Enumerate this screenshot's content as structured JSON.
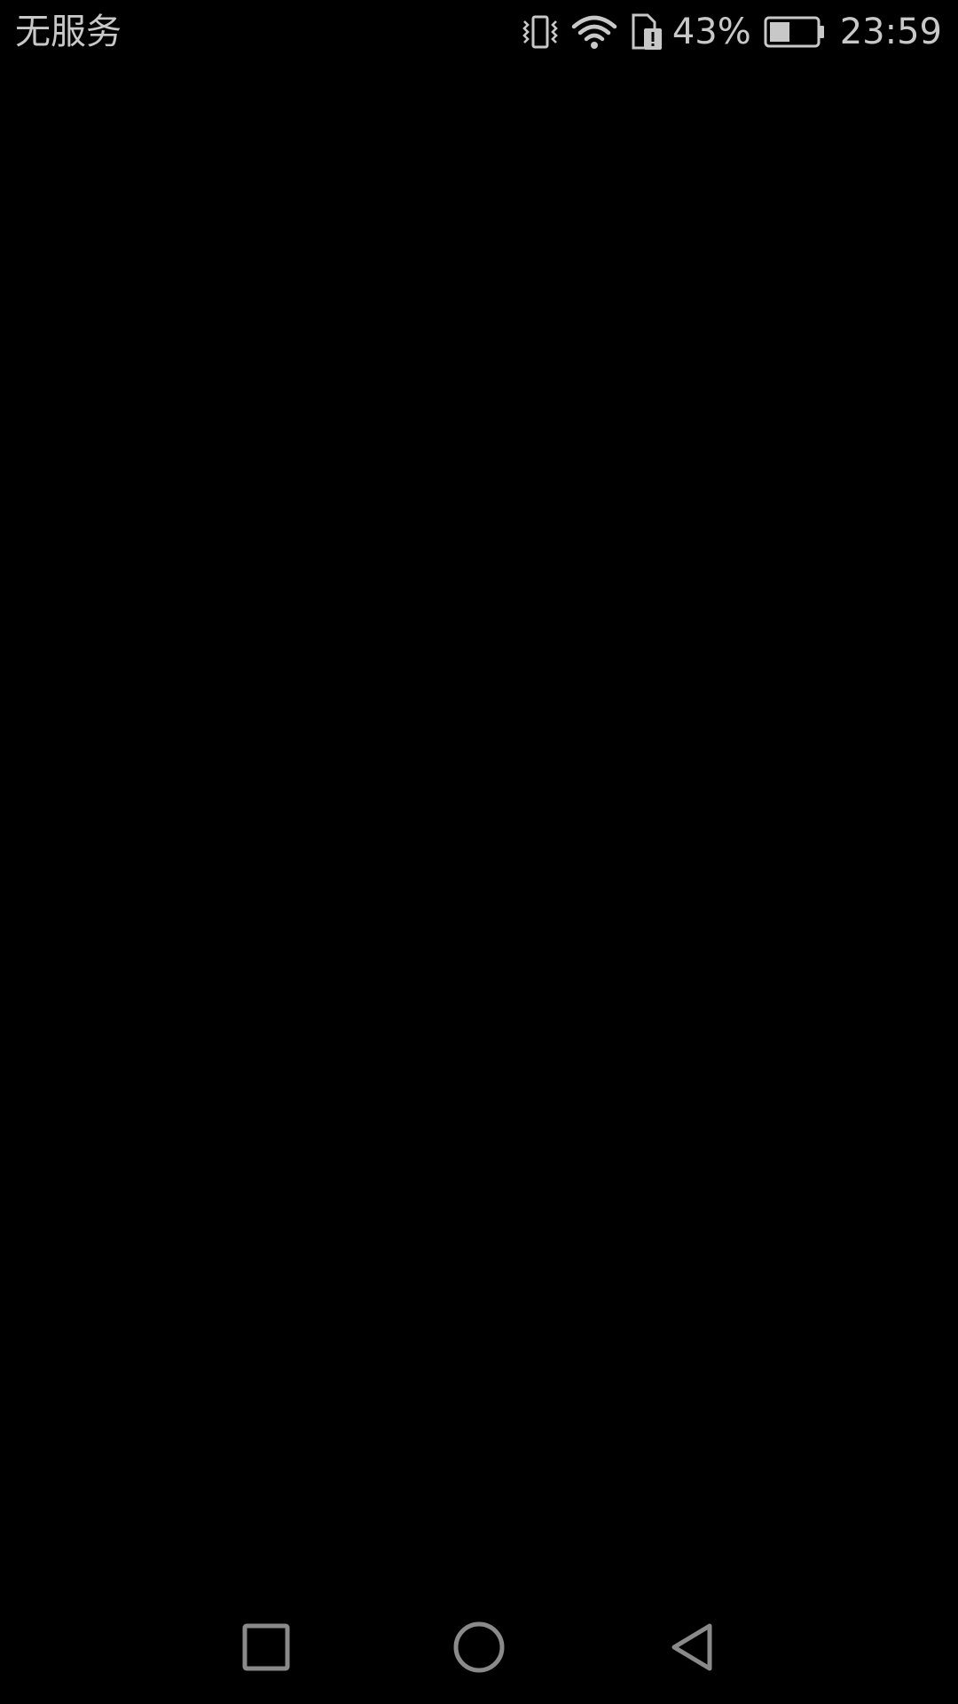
{
  "status_bar": {
    "carrier": "无服务",
    "battery_percent": "43%",
    "battery_level": 0.43,
    "time": "23:59",
    "icons": [
      "vibrate-icon",
      "wifi-icon",
      "sim-card-alert-icon",
      "battery-icon"
    ],
    "text_color": "#c8c8c8"
  },
  "nav_bar": {
    "buttons": [
      "recent-apps-icon",
      "home-icon",
      "back-icon"
    ],
    "icon_color": "#8a8a8a"
  },
  "screen": {
    "background": "#000000"
  }
}
